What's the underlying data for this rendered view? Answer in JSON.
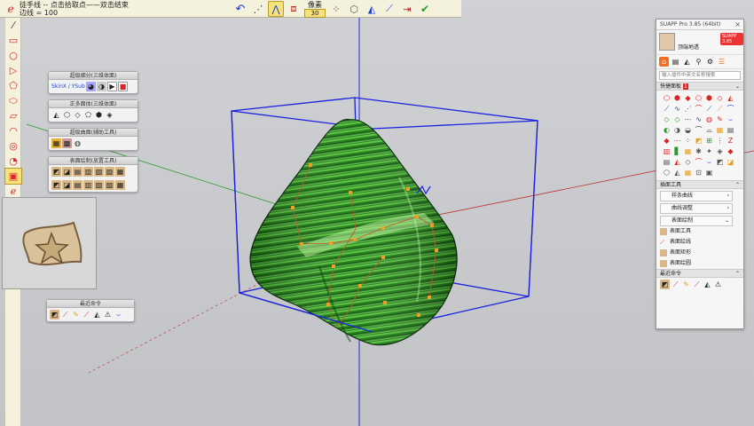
{
  "status": {
    "line1": "徒手线  --  点击拾取点——双击结束",
    "line2": "边线 = 100"
  },
  "toolbar": {
    "undo_icon": "undo-icon",
    "param_label": "像素",
    "param_value": "30"
  },
  "floating_toolbars": [
    {
      "title": "超级细分(三维体面)",
      "extra": "SkinX / YSub"
    },
    {
      "title": "正多面体(三维体面)"
    },
    {
      "title": "超级曲面(辅助工具)"
    },
    {
      "title": "表面绘制(放置工具)"
    },
    {
      "title": "最近命令"
    }
  ],
  "panel": {
    "title": "SUAPP Pro 3.85 (64bit)",
    "user": "顶端地透",
    "badge": "SUAPP 3.85",
    "search_placeholder": "输入插件中英文名称搜索",
    "quick_panel": "快捷面板",
    "quick_count": "1",
    "plugin_tools": "插面工具",
    "sub1": "样条曲线",
    "sub2": "曲线调整",
    "sub3": "表面绘制",
    "items": [
      "表面工具",
      "表面绘线",
      "表面矩形",
      "表面绘圆"
    ],
    "recent": "最近命令"
  },
  "colors": {
    "accent": "#f07020",
    "bounding_box": "#1a22e0",
    "surface": "#1f8a16"
  }
}
